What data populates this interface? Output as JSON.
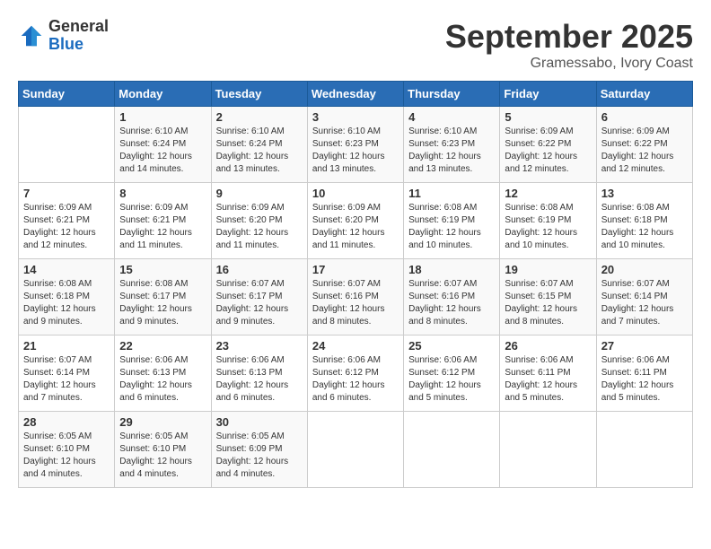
{
  "header": {
    "logo_general": "General",
    "logo_blue": "Blue",
    "month": "September 2025",
    "location": "Gramessabo, Ivory Coast"
  },
  "weekdays": [
    "Sunday",
    "Monday",
    "Tuesday",
    "Wednesday",
    "Thursday",
    "Friday",
    "Saturday"
  ],
  "weeks": [
    [
      {
        "day": "",
        "sunrise": "",
        "sunset": "",
        "daylight": ""
      },
      {
        "day": "1",
        "sunrise": "6:10 AM",
        "sunset": "6:24 PM",
        "dl1": "12 hours",
        "dl2": "and 14 minutes."
      },
      {
        "day": "2",
        "sunrise": "6:10 AM",
        "sunset": "6:24 PM",
        "dl1": "12 hours",
        "dl2": "and 13 minutes."
      },
      {
        "day": "3",
        "sunrise": "6:10 AM",
        "sunset": "6:23 PM",
        "dl1": "12 hours",
        "dl2": "and 13 minutes."
      },
      {
        "day": "4",
        "sunrise": "6:10 AM",
        "sunset": "6:23 PM",
        "dl1": "12 hours",
        "dl2": "and 13 minutes."
      },
      {
        "day": "5",
        "sunrise": "6:09 AM",
        "sunset": "6:22 PM",
        "dl1": "12 hours",
        "dl2": "and 12 minutes."
      },
      {
        "day": "6",
        "sunrise": "6:09 AM",
        "sunset": "6:22 PM",
        "dl1": "12 hours",
        "dl2": "and 12 minutes."
      }
    ],
    [
      {
        "day": "7",
        "sunrise": "6:09 AM",
        "sunset": "6:21 PM",
        "dl1": "12 hours",
        "dl2": "and 12 minutes."
      },
      {
        "day": "8",
        "sunrise": "6:09 AM",
        "sunset": "6:21 PM",
        "dl1": "12 hours",
        "dl2": "and 11 minutes."
      },
      {
        "day": "9",
        "sunrise": "6:09 AM",
        "sunset": "6:20 PM",
        "dl1": "12 hours",
        "dl2": "and 11 minutes."
      },
      {
        "day": "10",
        "sunrise": "6:09 AM",
        "sunset": "6:20 PM",
        "dl1": "12 hours",
        "dl2": "and 11 minutes."
      },
      {
        "day": "11",
        "sunrise": "6:08 AM",
        "sunset": "6:19 PM",
        "dl1": "12 hours",
        "dl2": "and 10 minutes."
      },
      {
        "day": "12",
        "sunrise": "6:08 AM",
        "sunset": "6:19 PM",
        "dl1": "12 hours",
        "dl2": "and 10 minutes."
      },
      {
        "day": "13",
        "sunrise": "6:08 AM",
        "sunset": "6:18 PM",
        "dl1": "12 hours",
        "dl2": "and 10 minutes."
      }
    ],
    [
      {
        "day": "14",
        "sunrise": "6:08 AM",
        "sunset": "6:18 PM",
        "dl1": "12 hours",
        "dl2": "and 9 minutes."
      },
      {
        "day": "15",
        "sunrise": "6:08 AM",
        "sunset": "6:17 PM",
        "dl1": "12 hours",
        "dl2": "and 9 minutes."
      },
      {
        "day": "16",
        "sunrise": "6:07 AM",
        "sunset": "6:17 PM",
        "dl1": "12 hours",
        "dl2": "and 9 minutes."
      },
      {
        "day": "17",
        "sunrise": "6:07 AM",
        "sunset": "6:16 PM",
        "dl1": "12 hours",
        "dl2": "and 8 minutes."
      },
      {
        "day": "18",
        "sunrise": "6:07 AM",
        "sunset": "6:16 PM",
        "dl1": "12 hours",
        "dl2": "and 8 minutes."
      },
      {
        "day": "19",
        "sunrise": "6:07 AM",
        "sunset": "6:15 PM",
        "dl1": "12 hours",
        "dl2": "and 8 minutes."
      },
      {
        "day": "20",
        "sunrise": "6:07 AM",
        "sunset": "6:14 PM",
        "dl1": "12 hours",
        "dl2": "and 7 minutes."
      }
    ],
    [
      {
        "day": "21",
        "sunrise": "6:07 AM",
        "sunset": "6:14 PM",
        "dl1": "12 hours",
        "dl2": "and 7 minutes."
      },
      {
        "day": "22",
        "sunrise": "6:06 AM",
        "sunset": "6:13 PM",
        "dl1": "12 hours",
        "dl2": "and 6 minutes."
      },
      {
        "day": "23",
        "sunrise": "6:06 AM",
        "sunset": "6:13 PM",
        "dl1": "12 hours",
        "dl2": "and 6 minutes."
      },
      {
        "day": "24",
        "sunrise": "6:06 AM",
        "sunset": "6:12 PM",
        "dl1": "12 hours",
        "dl2": "and 6 minutes."
      },
      {
        "day": "25",
        "sunrise": "6:06 AM",
        "sunset": "6:12 PM",
        "dl1": "12 hours",
        "dl2": "and 5 minutes."
      },
      {
        "day": "26",
        "sunrise": "6:06 AM",
        "sunset": "6:11 PM",
        "dl1": "12 hours",
        "dl2": "and 5 minutes."
      },
      {
        "day": "27",
        "sunrise": "6:06 AM",
        "sunset": "6:11 PM",
        "dl1": "12 hours",
        "dl2": "and 5 minutes."
      }
    ],
    [
      {
        "day": "28",
        "sunrise": "6:05 AM",
        "sunset": "6:10 PM",
        "dl1": "12 hours",
        "dl2": "and 4 minutes."
      },
      {
        "day": "29",
        "sunrise": "6:05 AM",
        "sunset": "6:10 PM",
        "dl1": "12 hours",
        "dl2": "and 4 minutes."
      },
      {
        "day": "30",
        "sunrise": "6:05 AM",
        "sunset": "6:09 PM",
        "dl1": "12 hours",
        "dl2": "and 4 minutes."
      },
      {
        "day": "",
        "sunrise": "",
        "sunset": "",
        "dl1": "",
        "dl2": ""
      },
      {
        "day": "",
        "sunrise": "",
        "sunset": "",
        "dl1": "",
        "dl2": ""
      },
      {
        "day": "",
        "sunrise": "",
        "sunset": "",
        "dl1": "",
        "dl2": ""
      },
      {
        "day": "",
        "sunrise": "",
        "sunset": "",
        "dl1": "",
        "dl2": ""
      }
    ]
  ],
  "labels": {
    "sunrise": "Sunrise:",
    "sunset": "Sunset:",
    "daylight": "Daylight:"
  }
}
